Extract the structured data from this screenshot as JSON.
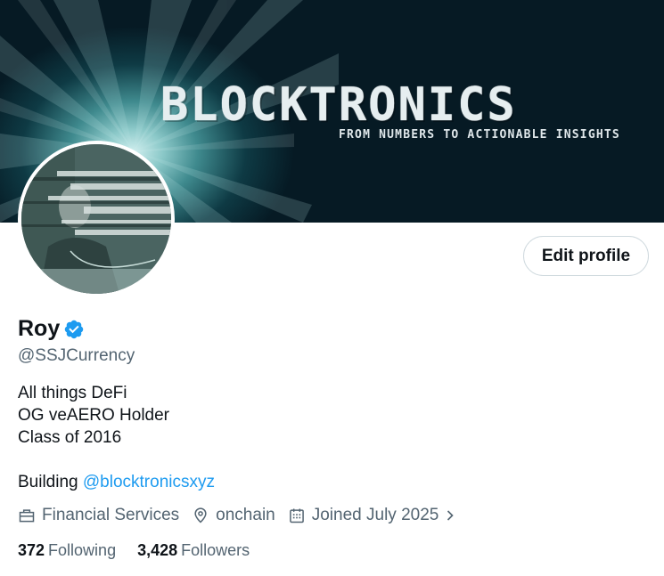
{
  "banner": {
    "title": "BLOCKTRONICS",
    "tagline": "FROM NUMBERS TO ACTIONABLE INSIGHTS"
  },
  "profile": {
    "name": "Roy",
    "handle": "@SSJCurrency",
    "verified": true,
    "edit_button_label": "Edit profile"
  },
  "bio": {
    "lines": [
      "All things DeFi",
      "OG veAERO Holder",
      "Class of 2016"
    ],
    "building_prefix": "Building ",
    "building_mention": "@blocktronicsxyz"
  },
  "meta": {
    "category": "Financial Services",
    "location": "onchain",
    "joined": "Joined July 2025"
  },
  "stats": {
    "following_count": "372",
    "following_label": "Following",
    "followers_count": "3,428",
    "followers_label": "Followers"
  },
  "colors": {
    "accent": "#1d9bf0",
    "muted_text": "#536471",
    "primary_text": "#0f1419"
  },
  "icons": {
    "verified": "verified-badge-icon",
    "category": "briefcase-icon",
    "location": "map-pin-icon",
    "joined": "calendar-icon",
    "joined_more": "chevron-right-icon"
  }
}
